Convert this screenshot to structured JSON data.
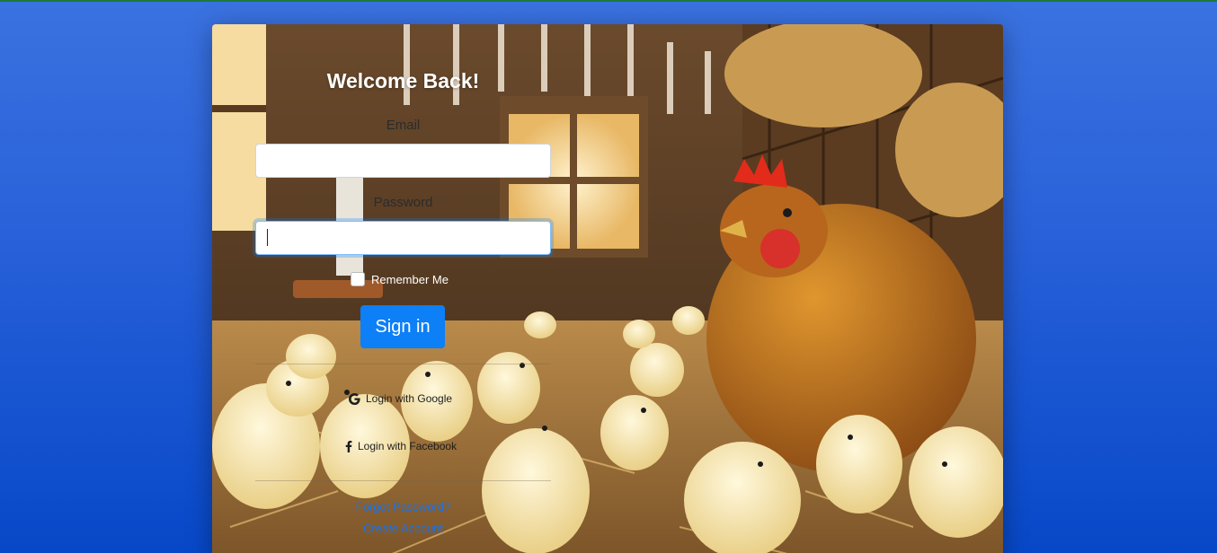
{
  "login": {
    "title": "Welcome Back!",
    "email_label": "Email",
    "email_value": "",
    "password_label": "Password",
    "password_value": "",
    "remember_label": "Remember Me",
    "remember_checked": false,
    "signin_label": "Sign in",
    "google_label": "Login with Google",
    "facebook_label": "Login with Facebook",
    "forgot_label": "Forgot Password?",
    "create_label": "Create Account"
  },
  "colors": {
    "page_top": "#3a72e0",
    "page_bottom": "#0748c8",
    "primary_button": "#0d7ff7",
    "link": "#1a73e8"
  },
  "icons": [
    "google-icon",
    "facebook-icon"
  ]
}
